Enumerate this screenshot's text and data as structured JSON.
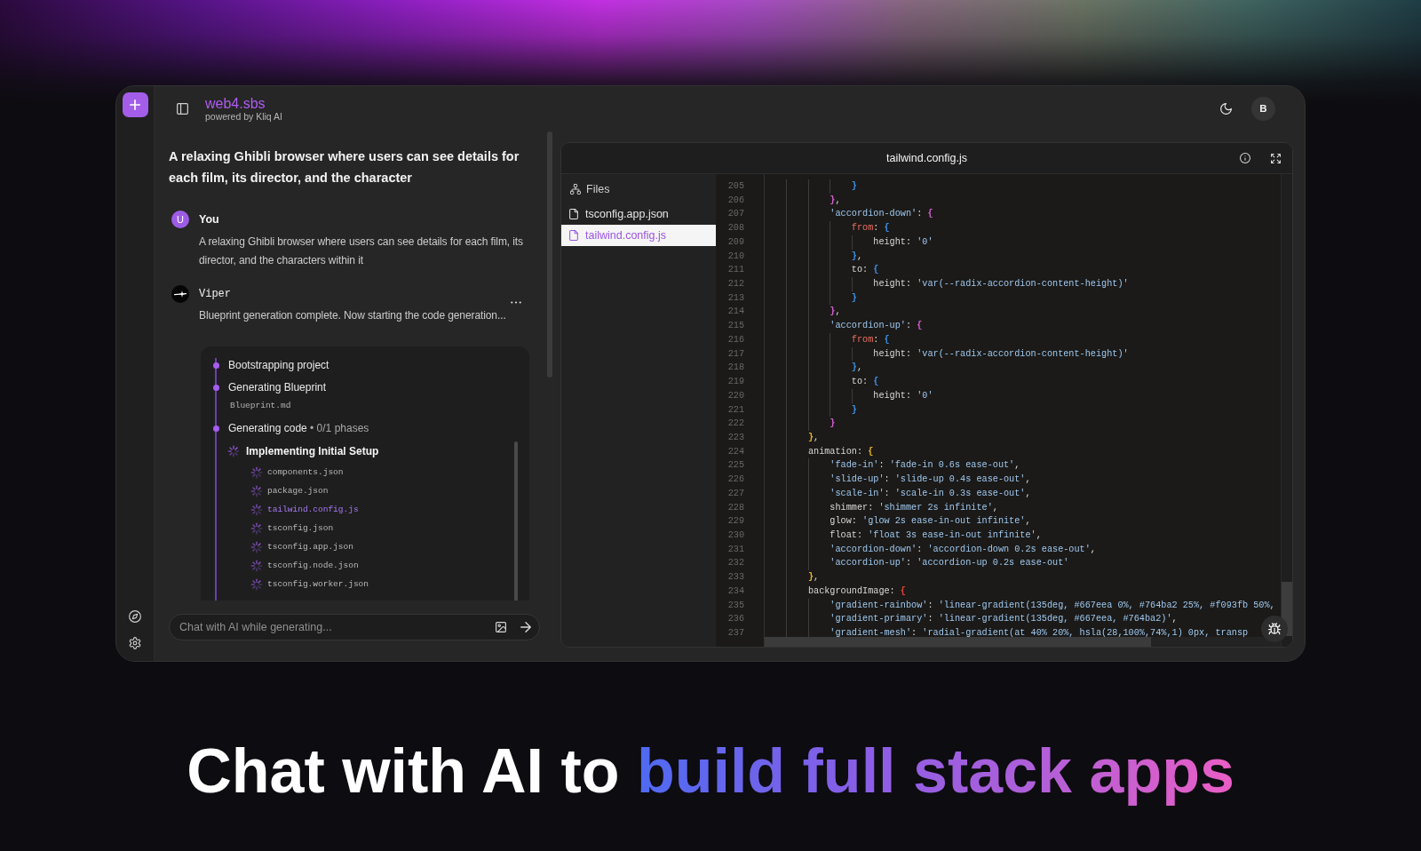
{
  "app": {
    "brand": "web4.sbs",
    "tagline": "powered by Kliq AI",
    "avatar": "B"
  },
  "chat": {
    "title": "A relaxing Ghibli browser where users can see details for each film, its director, and the character",
    "messages": [
      {
        "kind": "user",
        "author": "You",
        "avatar": "U",
        "text": "A relaxing Ghibli browser where users can see details for each film, its director, and the characters within it"
      },
      {
        "kind": "agent",
        "author": "Viper",
        "text": "Blueprint generation complete. Now starting the code generation..."
      }
    ],
    "progress": {
      "steps": [
        {
          "label": "Bootstrapping project"
        },
        {
          "label": "Generating Blueprint",
          "file": "Blueprint.md"
        },
        {
          "label": "Generating code",
          "detail": "• 0/1 phases",
          "phases": [
            {
              "title": "Implementing Initial Setup",
              "files": [
                {
                  "name": "components.json",
                  "active": false
                },
                {
                  "name": "package.json",
                  "active": false
                },
                {
                  "name": "tailwind.config.js",
                  "active": true
                },
                {
                  "name": "tsconfig.json",
                  "active": false
                },
                {
                  "name": "tsconfig.app.json",
                  "active": false
                },
                {
                  "name": "tsconfig.node.json",
                  "active": false
                },
                {
                  "name": "tsconfig.worker.json",
                  "active": false
                }
              ]
            }
          ]
        }
      ]
    },
    "input": {
      "placeholder": "Chat with AI while generating..."
    }
  },
  "editor": {
    "title": "tailwind.config.js",
    "files_heading": "Files",
    "files": [
      {
        "name": "tsconfig.app.json",
        "selected": false
      },
      {
        "name": "tailwind.config.js",
        "selected": true
      }
    ],
    "lines": [
      {
        "number": "205",
        "tokens": [
          {
            "kind": "brace",
            "text": "                }",
            "color": "#3b8fe8"
          }
        ]
      },
      {
        "number": "206",
        "tokens": [
          {
            "kind": "brace",
            "text": "            }",
            "color": "#d35fd0"
          },
          {
            "kind": "plain",
            "text": ","
          }
        ]
      },
      {
        "number": "207",
        "tokens": [
          {
            "kind": "string",
            "text": "            'accordion-down'"
          },
          {
            "kind": "plain",
            "text": ": "
          },
          {
            "kind": "brace",
            "text": "{",
            "color": "#d35fd0"
          }
        ]
      },
      {
        "number": "208",
        "tokens": [
          {
            "kind": "keyword",
            "text": "                from"
          },
          {
            "kind": "plain",
            "text": ": "
          },
          {
            "kind": "brace",
            "text": "{",
            "color": "#3b8fe8"
          }
        ]
      },
      {
        "number": "209",
        "tokens": [
          {
            "kind": "plain",
            "text": "                    height: "
          },
          {
            "kind": "string",
            "text": "'0'"
          }
        ]
      },
      {
        "number": "210",
        "tokens": [
          {
            "kind": "brace",
            "text": "                }",
            "color": "#3b8fe8"
          },
          {
            "kind": "plain",
            "text": ","
          }
        ]
      },
      {
        "number": "211",
        "tokens": [
          {
            "kind": "plain",
            "text": "                to: "
          },
          {
            "kind": "brace",
            "text": "{",
            "color": "#3b8fe8"
          }
        ]
      },
      {
        "number": "212",
        "tokens": [
          {
            "kind": "plain",
            "text": "                    height: "
          },
          {
            "kind": "string",
            "text": "'var(--radix-accordion-content-height)'"
          }
        ]
      },
      {
        "number": "213",
        "tokens": [
          {
            "kind": "brace",
            "text": "                }",
            "color": "#3b8fe8"
          }
        ]
      },
      {
        "number": "214",
        "tokens": [
          {
            "kind": "brace",
            "text": "            }",
            "color": "#d35fd0"
          },
          {
            "kind": "plain",
            "text": ","
          }
        ]
      },
      {
        "number": "215",
        "tokens": [
          {
            "kind": "string",
            "text": "            'accordion-up'"
          },
          {
            "kind": "plain",
            "text": ": "
          },
          {
            "kind": "brace",
            "text": "{",
            "color": "#d35fd0"
          }
        ]
      },
      {
        "number": "216",
        "tokens": [
          {
            "kind": "keyword",
            "text": "                from"
          },
          {
            "kind": "plain",
            "text": ": "
          },
          {
            "kind": "brace",
            "text": "{",
            "color": "#3b8fe8"
          }
        ]
      },
      {
        "number": "217",
        "tokens": [
          {
            "kind": "plain",
            "text": "                    height: "
          },
          {
            "kind": "string",
            "text": "'var(--radix-accordion-content-height)'"
          }
        ]
      },
      {
        "number": "218",
        "tokens": [
          {
            "kind": "brace",
            "text": "                }",
            "color": "#3b8fe8"
          },
          {
            "kind": "plain",
            "text": ","
          }
        ]
      },
      {
        "number": "219",
        "tokens": [
          {
            "kind": "plain",
            "text": "                to: "
          },
          {
            "kind": "brace",
            "text": "{",
            "color": "#3b8fe8"
          }
        ]
      },
      {
        "number": "220",
        "tokens": [
          {
            "kind": "plain",
            "text": "                    height: "
          },
          {
            "kind": "string",
            "text": "'0'"
          }
        ]
      },
      {
        "number": "221",
        "tokens": [
          {
            "kind": "brace",
            "text": "                }",
            "color": "#3b8fe8"
          }
        ]
      },
      {
        "number": "222",
        "tokens": [
          {
            "kind": "brace",
            "text": "            }",
            "color": "#d35fd0"
          }
        ]
      },
      {
        "number": "223",
        "tokens": [
          {
            "kind": "brace",
            "text": "        }",
            "color": "#e5b32a"
          },
          {
            "kind": "plain",
            "text": ","
          }
        ]
      },
      {
        "number": "224",
        "tokens": [
          {
            "kind": "plain",
            "text": "        animation: "
          },
          {
            "kind": "brace",
            "text": "{",
            "color": "#e5b32a"
          }
        ]
      },
      {
        "number": "225",
        "tokens": [
          {
            "kind": "string",
            "text": "            'fade-in'"
          },
          {
            "kind": "plain",
            "text": ": "
          },
          {
            "kind": "string",
            "text": "'fade-in 0.6s ease-out'"
          },
          {
            "kind": "plain",
            "text": ","
          }
        ]
      },
      {
        "number": "226",
        "tokens": [
          {
            "kind": "string",
            "text": "            'slide-up'"
          },
          {
            "kind": "plain",
            "text": ": "
          },
          {
            "kind": "string",
            "text": "'slide-up 0.4s ease-out'"
          },
          {
            "kind": "plain",
            "text": ","
          }
        ]
      },
      {
        "number": "227",
        "tokens": [
          {
            "kind": "string",
            "text": "            'scale-in'"
          },
          {
            "kind": "plain",
            "text": ": "
          },
          {
            "kind": "string",
            "text": "'scale-in 0.3s ease-out'"
          },
          {
            "kind": "plain",
            "text": ","
          }
        ]
      },
      {
        "number": "228",
        "tokens": [
          {
            "kind": "plain",
            "text": "            shimmer: "
          },
          {
            "kind": "string",
            "text": "'shimmer 2s infinite'"
          },
          {
            "kind": "plain",
            "text": ","
          }
        ]
      },
      {
        "number": "229",
        "tokens": [
          {
            "kind": "plain",
            "text": "            glow: "
          },
          {
            "kind": "string",
            "text": "'glow 2s ease-in-out infinite'"
          },
          {
            "kind": "plain",
            "text": ","
          }
        ]
      },
      {
        "number": "230",
        "tokens": [
          {
            "kind": "plain",
            "text": "            float: "
          },
          {
            "kind": "string",
            "text": "'float 3s ease-in-out infinite'"
          },
          {
            "kind": "plain",
            "text": ","
          }
        ]
      },
      {
        "number": "231",
        "tokens": [
          {
            "kind": "string",
            "text": "            'accordion-down'"
          },
          {
            "kind": "plain",
            "text": ": "
          },
          {
            "kind": "string",
            "text": "'accordion-down 0.2s ease-out'"
          },
          {
            "kind": "plain",
            "text": ","
          }
        ]
      },
      {
        "number": "232",
        "tokens": [
          {
            "kind": "string",
            "text": "            'accordion-up'"
          },
          {
            "kind": "plain",
            "text": ": "
          },
          {
            "kind": "string",
            "text": "'accordion-up 0.2s ease-out'"
          }
        ]
      },
      {
        "number": "233",
        "tokens": [
          {
            "kind": "brace",
            "text": "        }",
            "color": "#e5b32a"
          },
          {
            "kind": "plain",
            "text": ","
          }
        ]
      },
      {
        "number": "234",
        "tokens": [
          {
            "kind": "plain",
            "text": "        backgroundImage: "
          },
          {
            "kind": "brace",
            "text": "{",
            "color": "#e5433b"
          }
        ]
      },
      {
        "number": "235",
        "tokens": [
          {
            "kind": "string",
            "text": "            'gradient-rainbow'"
          },
          {
            "kind": "plain",
            "text": ": "
          },
          {
            "kind": "string",
            "text": "'linear-gradient(135deg, #667eea 0%, #764ba2 25%, #f093fb 50%,"
          }
        ]
      },
      {
        "number": "236",
        "tokens": [
          {
            "kind": "string",
            "text": "            'gradient-primary'"
          },
          {
            "kind": "plain",
            "text": ": "
          },
          {
            "kind": "string",
            "text": "'linear-gradient(135deg, #667eea, #764ba2)'"
          },
          {
            "kind": "plain",
            "text": ","
          }
        ]
      },
      {
        "number": "237",
        "tokens": [
          {
            "kind": "string",
            "text": "            'gradient-mesh'"
          },
          {
            "kind": "plain",
            "text": ": "
          },
          {
            "kind": "string",
            "text": "'radial-gradient(at 40% 20%, hsla(28,100%,74%,1) 0px, transp"
          }
        ]
      }
    ]
  },
  "headline": {
    "lead": "Chat with AI to",
    "highlight": "build full stack apps"
  }
}
